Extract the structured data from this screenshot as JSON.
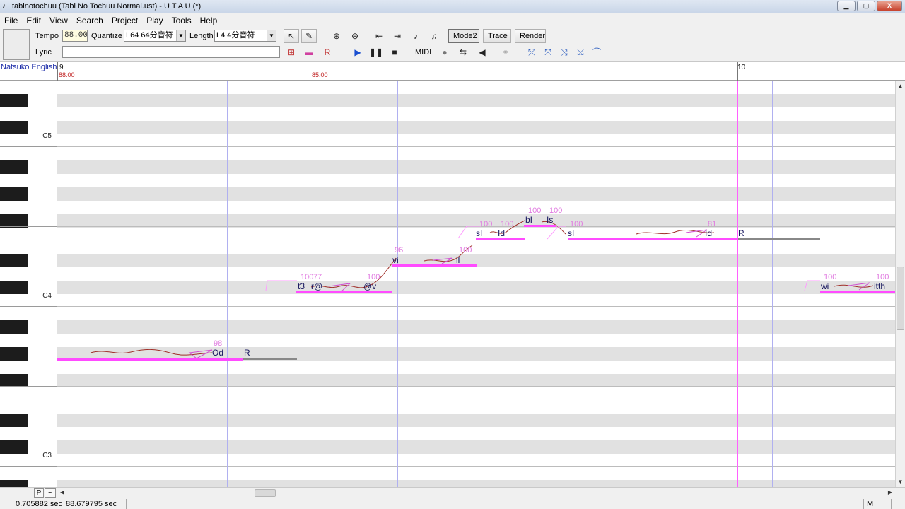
{
  "window": {
    "title": "tabinotochuu (Tabi No Tochuu Normal.ust) - U T A U (*)",
    "minimize": "▁",
    "maximize": "▢",
    "close": "X"
  },
  "menu": [
    "File",
    "Edit",
    "View",
    "Search",
    "Project",
    "Play",
    "Tools",
    "Help"
  ],
  "toolbar": {
    "tempo_label": "Tempo",
    "tempo_value": "88.00",
    "quantize_label": "Quantize",
    "quantize_value": "L64 64分音符",
    "length_label": "Length",
    "length_value": "L4  4分音符",
    "lyric_label": "Lyric",
    "lyric_value": "",
    "mode2": "Mode2",
    "trace": "Trace",
    "render": "Render",
    "midi": "MIDI"
  },
  "track": {
    "singer": "Natsuko English",
    "measure_9": "9",
    "measure_10": "10",
    "tempo_mark_1": "88.00",
    "tempo_mark_2": "85.00"
  },
  "keyboard": {
    "c5": "C5",
    "c4": "C4",
    "c3": "C3"
  },
  "notes": [
    {
      "lyric": "Od",
      "velocity": "98"
    },
    {
      "lyric": "R",
      "velocity": ""
    },
    {
      "lyric": "t3",
      "velocity": "100"
    },
    {
      "lyric": "r@",
      "velocity": "77"
    },
    {
      "lyric": "@v",
      "velocity": "100"
    },
    {
      "lyric": "vi",
      "velocity": "96"
    },
    {
      "lyric": "il",
      "velocity": "100"
    },
    {
      "lyric": "sI",
      "velocity": "100"
    },
    {
      "lyric": "Id",
      "velocity": "100"
    },
    {
      "lyric": "bI",
      "velocity": "100"
    },
    {
      "lyric": "Is",
      "velocity": "100"
    },
    {
      "lyric": "sI",
      "velocity": "100"
    },
    {
      "lyric": "Id",
      "velocity": "81"
    },
    {
      "lyric": "R",
      "velocity": ""
    },
    {
      "lyric": "wi",
      "velocity": "100"
    },
    {
      "lyric": "itth",
      "velocity": "100"
    }
  ],
  "status": {
    "time_1": "0.705882 sec",
    "time_2": "88.679795 sec",
    "mode": "M"
  },
  "colors": {
    "note": "#ff4bff",
    "velocity": "#e07ae0",
    "pitch_curve": "#a0302a",
    "beat_line": "#b0b0f0",
    "cursor_line": "#ff60ff"
  },
  "icons": {
    "tools": [
      "pointer-icon",
      "pencil-icon",
      "zoom-in-icon",
      "zoom-out-icon",
      "jump-start-icon",
      "jump-end-icon",
      "note-left-icon",
      "note-right-icon"
    ],
    "playback": [
      "play-icon",
      "pause-icon",
      "stop-icon",
      "record-icon",
      "loop-icon",
      "speaker-icon",
      "metronome-icon"
    ],
    "edit": [
      "insert-note-icon",
      "delete-note-icon",
      "rest-icon"
    ],
    "envelope": [
      "envelope-a-icon",
      "envelope-b-icon",
      "envelope-c-icon",
      "envelope-d-icon",
      "envelope-e-icon"
    ]
  }
}
